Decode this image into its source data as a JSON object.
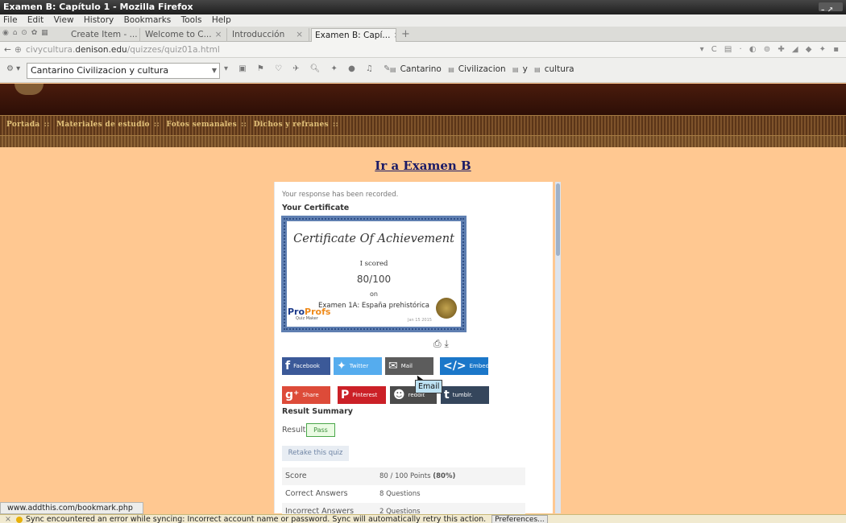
{
  "window": {
    "title": "Examen B: Capítulo 1 - Mozilla Firefox"
  },
  "menu": [
    "File",
    "Edit",
    "View",
    "History",
    "Bookmarks",
    "Tools",
    "Help"
  ],
  "tabs": [
    {
      "label": "Create Item - ...",
      "active": false
    },
    {
      "label": "Welcome to C...",
      "active": false
    },
    {
      "label": "Introducción",
      "active": false
    },
    {
      "label": "Examen B: Capí...",
      "active": true
    }
  ],
  "url": {
    "prefix": "civycultura.",
    "domain": "denison.edu",
    "path": "/quizzes/quiz01a.html"
  },
  "search": {
    "engine": "Cantarino Civilizacion y cultura",
    "terms": [
      "Cantarino",
      "Civilizacion",
      "y",
      "cultura"
    ]
  },
  "site": {
    "nav": [
      "Portada",
      "Materiales de estudio",
      "Fotos semanales",
      "Dichos y refranes"
    ],
    "ir_link": "Ir a Examen B"
  },
  "quiz": {
    "recorded": "Your response has been recorded.",
    "your_certificate": "Your Certificate",
    "certificate": {
      "title": "Certificate Of Achievement",
      "scored": "I scored",
      "score": "80/100",
      "on": "on",
      "quiz_name": "Examen 1A: España prehistórica",
      "logo_a": "Pro",
      "logo_b": "Profs",
      "logo_sub": "Quiz Maker",
      "date": "Jan 15 2015"
    },
    "share": {
      "facebook": "Facebook",
      "twitter": "Twitter",
      "mail": "Mail",
      "embed": "Embed",
      "gplus": "Share",
      "pinterest": "Pinterest",
      "reddit": "reddit",
      "tumblr": "tumblr.",
      "tooltip": "Email"
    },
    "result_summary": "Result Summary",
    "result_label": "Result",
    "result_value": "Pass",
    "retake": "Retake this quiz",
    "stats": [
      {
        "key": "Score",
        "value": "80 / 100 Points",
        "extra": "(80%)"
      },
      {
        "key": "Correct Answers",
        "value": "8 Questions",
        "extra": ""
      },
      {
        "key": "Incorrect Answers",
        "value": "2 Questions",
        "extra": ""
      }
    ]
  },
  "status": {
    "url": "www.addthis.com/bookmark.php",
    "message": "Sync encountered an error while syncing: Incorrect account name or password. Sync will automatically retry this action.",
    "button": "Preferences..."
  }
}
